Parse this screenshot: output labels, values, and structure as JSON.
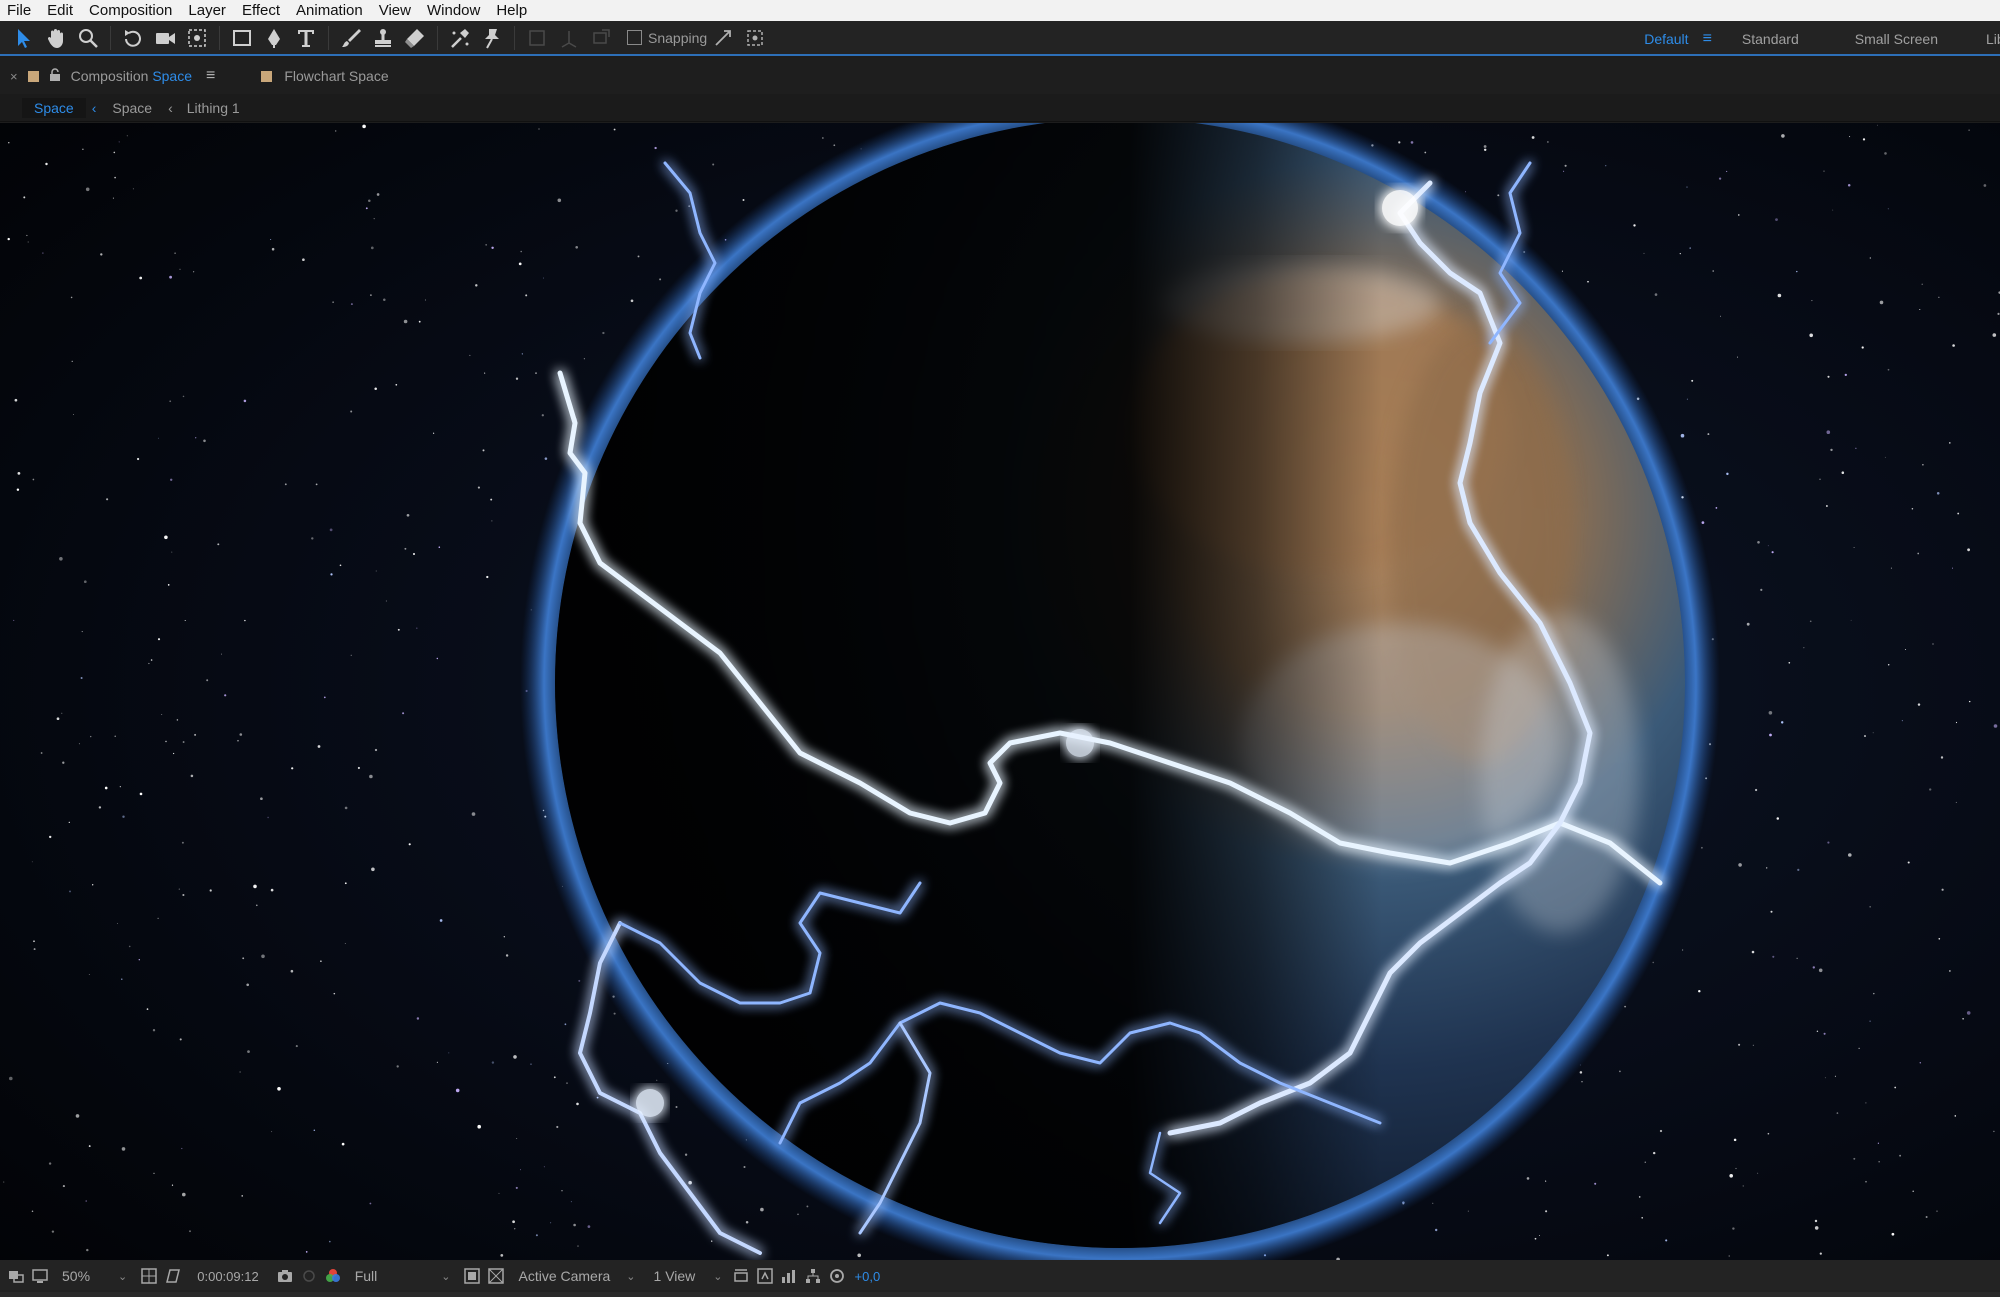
{
  "menu": [
    "File",
    "Edit",
    "Composition",
    "Layer",
    "Effect",
    "Animation",
    "View",
    "Window",
    "Help"
  ],
  "toolbar": {
    "tools": [
      "selection-tool-icon",
      "hand-tool-icon",
      "zoom-tool-icon",
      "rotate-tool-icon",
      "camera-tool-icon",
      "pan-behind-tool-icon",
      "rectangle-tool-icon",
      "pen-tool-icon",
      "type-tool-icon",
      "brush-tool-icon",
      "clone-stamp-tool-icon",
      "eraser-tool-icon",
      "roto-brush-tool-icon",
      "puppet-pin-tool-icon"
    ],
    "snapping_label": "Snapping",
    "workspaces": [
      "Default",
      "Standard",
      "Small Screen",
      "Lib"
    ],
    "active_workspace": "Default"
  },
  "panel": {
    "comp_tab_prefix": "Composition",
    "comp_tab_name": "Space",
    "flowchart_tab": "Flowchart Space",
    "breadcrumbs": [
      "Space",
      "Space",
      "Lithing 1"
    ]
  },
  "status": {
    "zoom": "50%",
    "timecode": "0:00:09:12",
    "resolution": "Full",
    "camera": "Active Camera",
    "views": "1 View",
    "exposure": "+0,0"
  },
  "colors": {
    "accent": "#2e8ce8",
    "label_swatch": "#c9a77a"
  }
}
